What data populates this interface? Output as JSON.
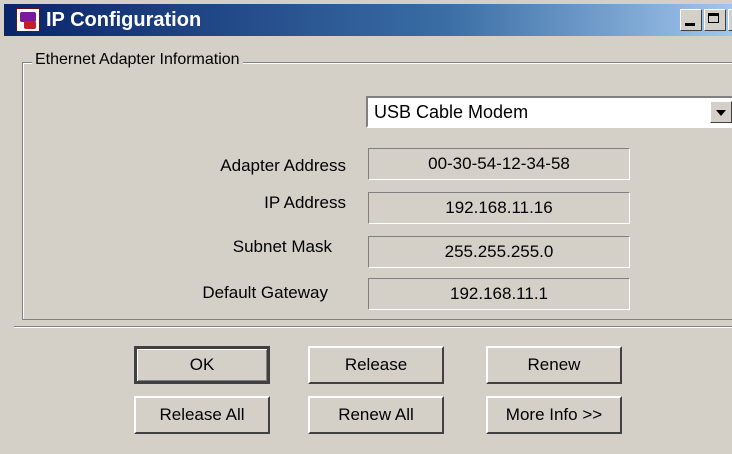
{
  "window": {
    "title": "IP Configuration",
    "minimize_glyph": "_",
    "maximize_glyph": "□",
    "close_glyph": "x"
  },
  "group": {
    "title": "Ethernet  Adapter Information"
  },
  "adapter_select": {
    "selected": "USB Cable Modem"
  },
  "fields": [
    {
      "label": "Adapter Address",
      "value": "00-30-54-12-34-58"
    },
    {
      "label": "IP Address",
      "value": "192.168.11.16"
    },
    {
      "label": "Subnet Mask",
      "value": "255.255.255.0"
    },
    {
      "label": "Default Gateway",
      "value": "192.168.11.1"
    }
  ],
  "buttons": {
    "ok": "OK",
    "release": "Release",
    "renew": "Renew",
    "release_all": "Release All",
    "renew_all": "Renew All",
    "more_info": "More Info >>"
  },
  "colors": {
    "title_gradient_start": "#0a246a",
    "title_gradient_end": "#a6caf0",
    "dialog_face": "#d4d0c8"
  }
}
